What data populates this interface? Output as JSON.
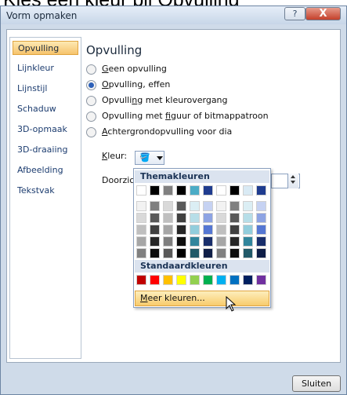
{
  "page_title": "Kies een kleur bij Opvulling",
  "window": {
    "title": "Vorm opmaken",
    "help_label": "?",
    "close_label": "X"
  },
  "sidebar": {
    "items": [
      {
        "label": "Opvulling"
      },
      {
        "label": "Lijnkleur"
      },
      {
        "label": "Lijnstijl"
      },
      {
        "label": "Schaduw"
      },
      {
        "label": "3D-opmaak"
      },
      {
        "label": "3D-draaiing"
      },
      {
        "label": "Afbeelding"
      },
      {
        "label": "Tekstvak"
      }
    ]
  },
  "main": {
    "section_title": "Opvulling",
    "options": [
      {
        "pre": "",
        "ul": "G",
        "post": "een opvulling",
        "selected": false
      },
      {
        "pre": "",
        "ul": "O",
        "post": "pvulling, effen",
        "selected": true
      },
      {
        "pre": "Opvulli",
        "ul": "n",
        "post": "g met kleurovergang",
        "selected": false
      },
      {
        "pre": "Opvulling met ",
        "ul": "f",
        "post": "iguur of bitmappatroon",
        "selected": false
      },
      {
        "pre": "",
        "ul": "A",
        "post": "chtergrondopvulling voor dia",
        "selected": false
      }
    ],
    "color_label_pre": "",
    "color_label_ul": "K",
    "color_label_post": "leur:",
    "transparency_label_pre": "Doorzich",
    "transparency_label_ul": "t"
  },
  "palette": {
    "theme_header": "Themakleuren",
    "standard_header": "Standaardkleuren",
    "more_colors_pre": "",
    "more_colors_ul": "M",
    "more_colors_post": "eer kleuren...",
    "theme_base": [
      "#ffffff",
      "#000000",
      "#808080",
      "#000000",
      "#4bacc6",
      "#1f3c8f",
      "#ffffff",
      "#000000",
      "#d9eaf4",
      "#1f3c8f"
    ],
    "theme_shades": [
      [
        "#f2f2f2",
        "#7f7f7f",
        "#d9d9d9",
        "#595959",
        "#dbeef4",
        "#c6d2f2",
        "#f2f2f2",
        "#808080",
        "#dbeef4",
        "#c6d2f2"
      ],
      [
        "#d9d9d9",
        "#595959",
        "#bfbfbf",
        "#404040",
        "#b7dee8",
        "#8ea4e3",
        "#d9d9d9",
        "#595959",
        "#b7dee8",
        "#8ea4e3"
      ],
      [
        "#bfbfbf",
        "#404040",
        "#a6a6a6",
        "#262626",
        "#92cddc",
        "#5577d3",
        "#bfbfbf",
        "#404040",
        "#92cddc",
        "#5577d3"
      ],
      [
        "#a6a6a6",
        "#262626",
        "#7f7f7f",
        "#0d0d0d",
        "#31859c",
        "#192e6b",
        "#a6a6a6",
        "#262626",
        "#31859c",
        "#192e6b"
      ],
      [
        "#808080",
        "#0d0d0d",
        "#595959",
        "#000000",
        "#215968",
        "#0f1e47",
        "#808080",
        "#0d0d0d",
        "#215968",
        "#0f1e47"
      ]
    ],
    "standard": [
      "#c00000",
      "#ff0000",
      "#ffc000",
      "#ffff00",
      "#92d050",
      "#00b050",
      "#00b0f0",
      "#0070c0",
      "#002060",
      "#7030a0"
    ]
  },
  "footer": {
    "close_button": "Sluiten"
  }
}
